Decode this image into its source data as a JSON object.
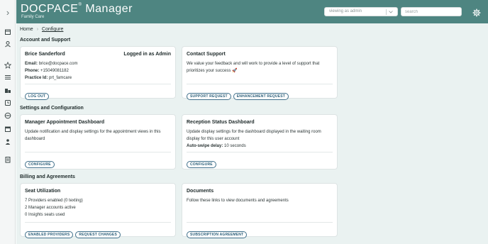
{
  "app": {
    "brand": "DOCPACE",
    "brand_reg": "®",
    "brand_suffix": "Manager",
    "subtitle": "Family Care"
  },
  "header": {
    "viewing_value": "viewing as admin",
    "search_placeholder": "search"
  },
  "breadcrumb": {
    "home": "Home",
    "current": "Configure"
  },
  "sidebar": {
    "expand_glyph": "›",
    "icons": [
      "calendar-icon",
      "user-icon",
      "star-icon",
      "list-icon",
      "building-icon",
      "clock-icon",
      "globe-icon",
      "calendar-grid-icon",
      "person-icon",
      "document-icon"
    ]
  },
  "sections": {
    "account": "Account and Support",
    "settings": "Settings and Configuration",
    "billing": "Billing and Agreements"
  },
  "account_card": {
    "name": "Brice Sanderford",
    "status": "Logged in as Admin",
    "email_label": "Email:",
    "email": "brice@docpace.com",
    "phone_label": "Phone:",
    "phone": "+15049081182",
    "practice_label": "Practice Id:",
    "practice": "prt_famcare",
    "logout": "LOG OUT"
  },
  "support_card": {
    "title": "Contact Support",
    "text": "We value your feedback and will work to provide a level of support that prioritizes your success 🚀",
    "support_button": "SUPPORT REQUEST",
    "enhancement_button": "ENHANCEMENT REQUEST"
  },
  "appointment_card": {
    "title": "Manager Appointment Dashboard",
    "text": "Update notification and display settings for the appointment views in this dashboard",
    "button": "CONFIGURE"
  },
  "reception_card": {
    "title": "Reception Status Dashboard",
    "text": "Update display settings for the dashboard displayed in the waiting room display for this user account",
    "delay_label": "Auto-swipe delay:",
    "delay_value": "10 seconds",
    "button": "CONFIGURE"
  },
  "seat_card": {
    "title": "Seat Utilization",
    "line1": "7 Providers enabled (0 texting)",
    "line2": "2 Manager accounts active",
    "line3": "0 Insights seats used",
    "enabled_button": "ENABLED PROVIDERS",
    "request_button": "REQUEST CHANGES"
  },
  "documents_card": {
    "title": "Documents",
    "text": "Follow these links to view documents and agreements",
    "button": "SUBSCRIPTION AGREEMENT"
  },
  "colors": {
    "header": "#4e8581",
    "background": "#eaf2f1",
    "button_border": "#3f6f8a"
  }
}
